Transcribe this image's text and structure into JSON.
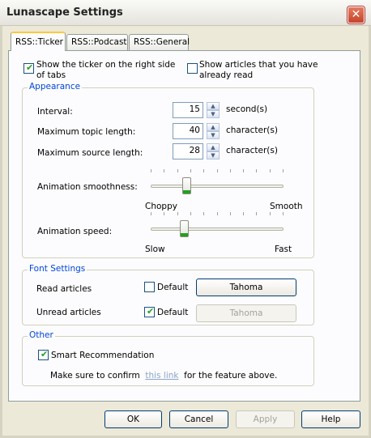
{
  "window": {
    "title": "Lunascape Settings",
    "close_glyph": "✕"
  },
  "tabs": [
    {
      "label": "RSS::Ticker",
      "active": true
    },
    {
      "label": "RSS::Podcast",
      "active": false
    },
    {
      "label": "RSS::General",
      "active": false
    }
  ],
  "ticker": {
    "show_right_label_line1": "Show the ticker on the right side",
    "show_right_label_line2": "of tabs",
    "show_right_checked": true,
    "show_read_label_line1": "Show articles that you have",
    "show_read_label_line2": "already read",
    "show_read_checked": false
  },
  "appearance": {
    "title": "Appearance",
    "interval_label": "Interval:",
    "interval_value": "15",
    "interval_unit": "second(s)",
    "topic_label": "Maximum topic length:",
    "topic_value": "40",
    "topic_unit": "character(s)",
    "source_label": "Maximum source length:",
    "source_value": "28",
    "source_unit": "character(s)",
    "smoothness_label": "Animation smoothness:",
    "smoothness_min": "Choppy",
    "smoothness_max": "Smooth",
    "smoothness_level": 0.27,
    "speed_label": "Animation speed:",
    "speed_min": "Slow",
    "speed_max": "Fast",
    "speed_level": 0.25
  },
  "fonts": {
    "title": "Font Settings",
    "read_label": "Read articles",
    "read_default_label": "Default",
    "read_default_checked": false,
    "read_font": "Tahoma",
    "unread_label": "Unread articles",
    "unread_default_label": "Default",
    "unread_default_checked": true,
    "unread_font": "Tahoma"
  },
  "other": {
    "title": "Other",
    "smart_label": "Smart Recommendation",
    "smart_checked": true,
    "confirm_before": "Make sure to confirm",
    "confirm_link": "this link",
    "confirm_after": "for the feature above."
  },
  "buttons": {
    "ok": "OK",
    "cancel": "Cancel",
    "apply": "Apply",
    "help": "Help"
  },
  "icons": {
    "spin_up": "▲",
    "spin_down": "▼",
    "check": "✔"
  }
}
